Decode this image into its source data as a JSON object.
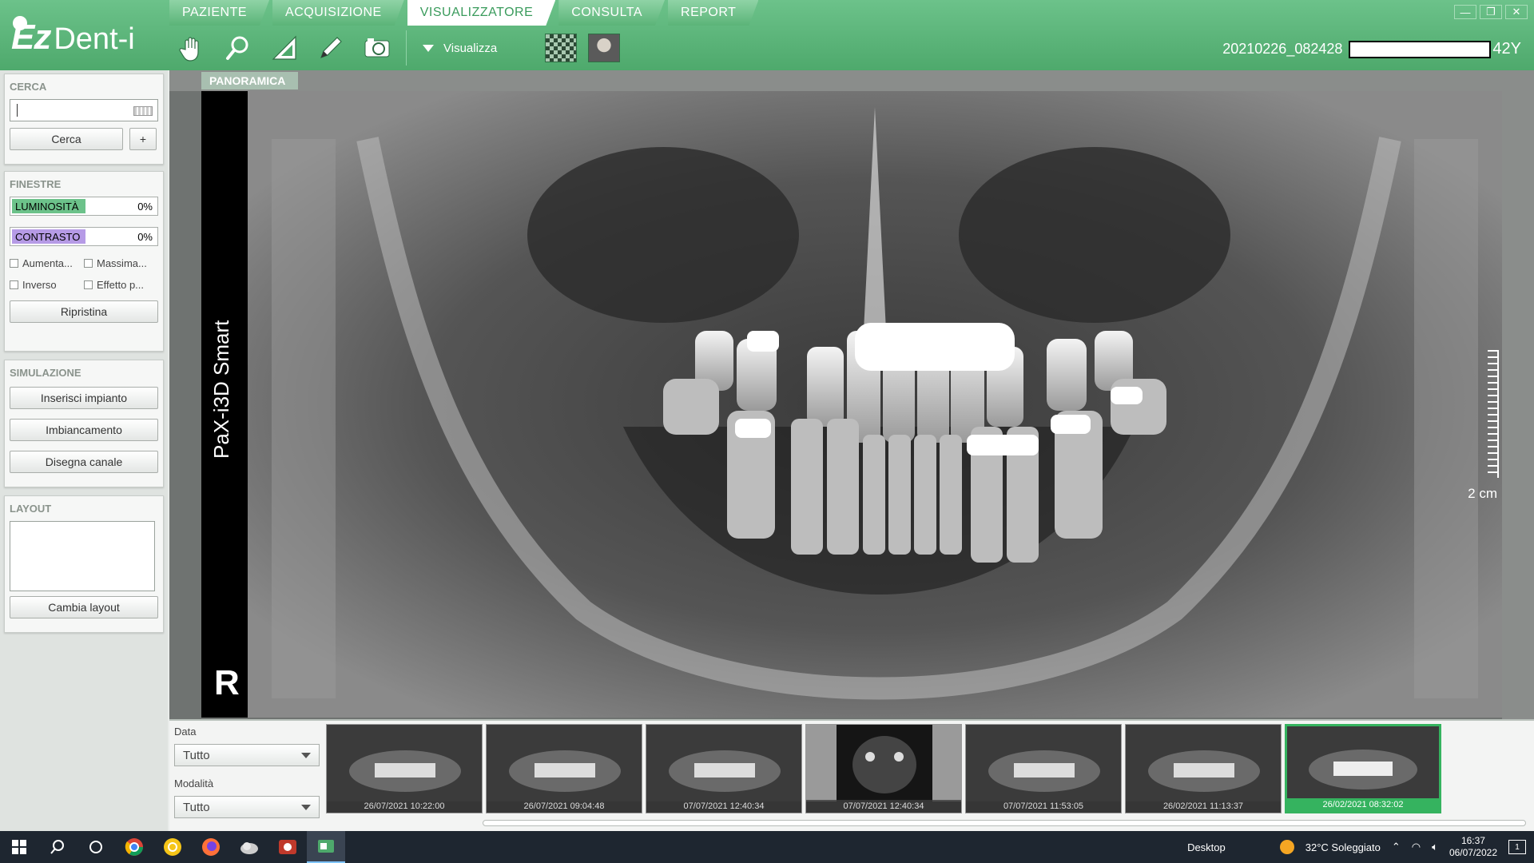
{
  "app": {
    "logo_ez": "Ez",
    "logo_rest": "Dent-i",
    "tabs": [
      {
        "label": "PAZIENTE"
      },
      {
        "label": "ACQUISIZIONE"
      },
      {
        "label": "VISUALIZZATORE"
      },
      {
        "label": "CONSULTA"
      },
      {
        "label": "REPORT"
      }
    ],
    "active_tab": "VISUALIZZATORE",
    "toolbar": {
      "visualizza_label": "Visualizza",
      "tools": [
        "hand-icon",
        "zoom-icon",
        "ruler-angle-icon",
        "pencil-icon",
        "camera-refresh-icon"
      ]
    },
    "patient": {
      "id": "20210226_082428",
      "age": "42Y"
    },
    "window_controls": [
      "—",
      "❐",
      "✕"
    ]
  },
  "left_panel": {
    "cerca": {
      "title": "CERCA",
      "button": "Cerca",
      "plus": "+"
    },
    "finestre": {
      "title": "FINESTRE",
      "luminosita": {
        "label": "LUMINOSITÀ",
        "value": "0%",
        "color": "#6cc28a"
      },
      "contrasto": {
        "label": "CONTRASTO",
        "value": "0%",
        "color": "#b69be6"
      },
      "checks": [
        "Aumenta...",
        "Massima...",
        "Inverso",
        "Effetto p..."
      ],
      "reset": "Ripristina"
    },
    "simulazione": {
      "title": "SIMULAZIONE",
      "buttons": [
        "Inserisci impianto",
        "Imbiancamento",
        "Disegna canale"
      ]
    },
    "layout": {
      "title": "LAYOUT",
      "button": "Cambia layout"
    }
  },
  "viewer": {
    "label": "PANORAMICA",
    "device": "PaX-i3D Smart",
    "side_mark": "R",
    "scale_label": "2 cm"
  },
  "bottom": {
    "data_label": "Data",
    "data_value": "Tutto",
    "modalita_label": "Modalità",
    "modalita_value": "Tutto",
    "thumbnails": [
      {
        "date": "26/07/2021 10:22:00"
      },
      {
        "date": "26/07/2021 09:04:48"
      },
      {
        "date": "07/07/2021 12:40:34"
      },
      {
        "date": "07/07/2021 12:40:34"
      },
      {
        "date": "07/07/2021 11:53:05"
      },
      {
        "date": "26/02/2021 11:13:37"
      },
      {
        "date": "26/02/2021 08:32:02"
      }
    ],
    "active_thumbnail": 6
  },
  "taskbar": {
    "desktop": "Desktop",
    "weather": "32°C  Soleggiato",
    "time": "16:37",
    "date": "06/07/2022",
    "notif": "1"
  }
}
